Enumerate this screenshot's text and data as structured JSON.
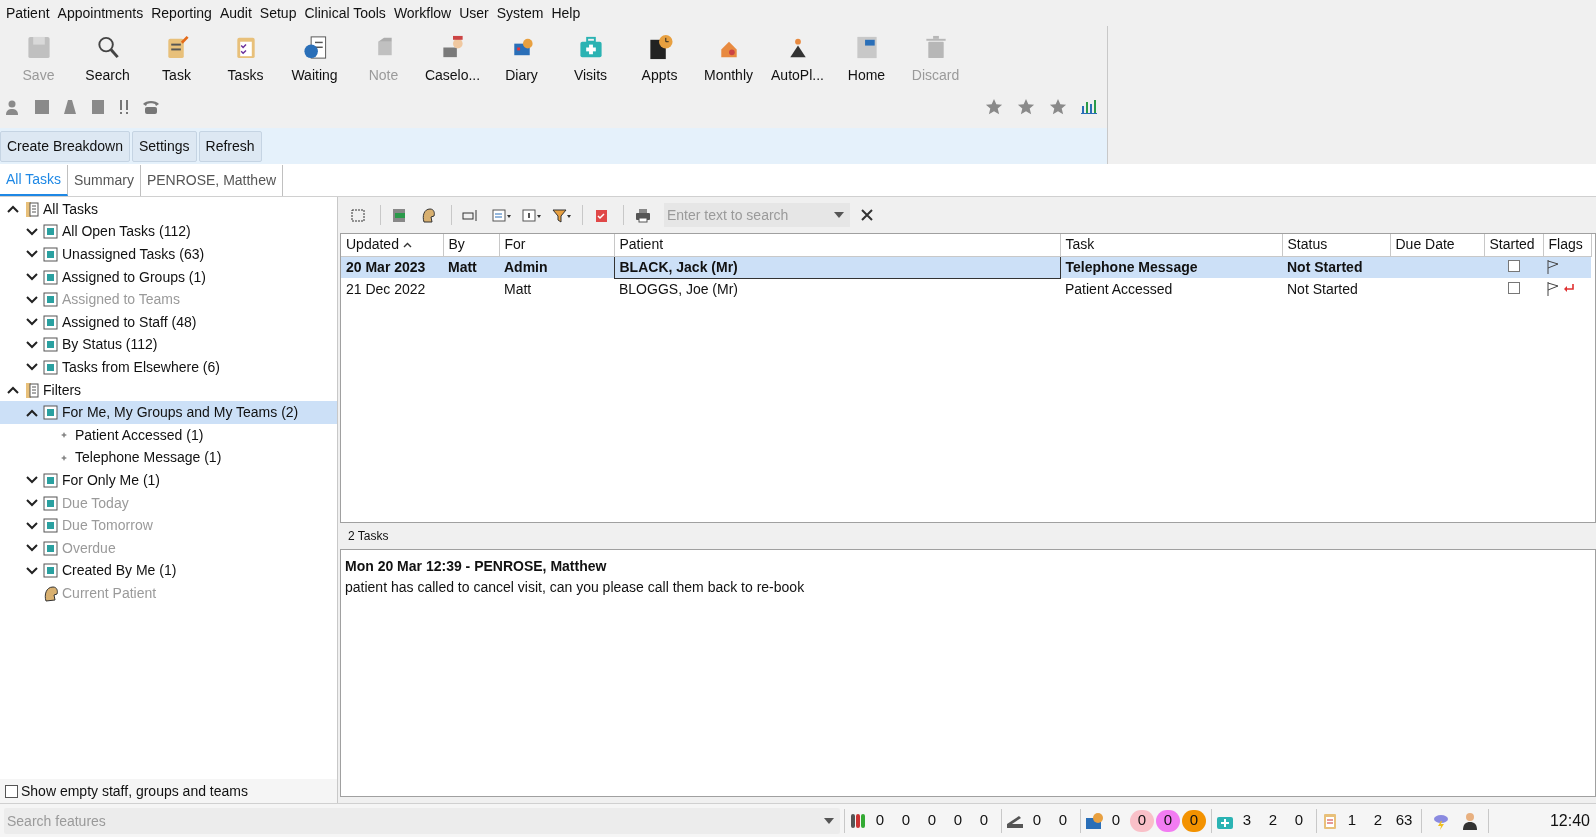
{
  "menu": [
    "Patient",
    "Appointments",
    "Reporting",
    "Audit",
    "Setup",
    "Clinical Tools",
    "Workflow",
    "User",
    "System",
    "Help"
  ],
  "toolbar": [
    {
      "label": "Save",
      "disabled": true
    },
    {
      "label": "Search",
      "disabled": false
    },
    {
      "label": "Task",
      "disabled": false
    },
    {
      "label": "Tasks",
      "disabled": false
    },
    {
      "label": "Waiting",
      "disabled": false
    },
    {
      "label": "Note",
      "disabled": true
    },
    {
      "label": "Caselo...",
      "disabled": false
    },
    {
      "label": "Diary",
      "disabled": false
    },
    {
      "label": "Visits",
      "disabled": false
    },
    {
      "label": "Appts",
      "disabled": false
    },
    {
      "label": "Monthly",
      "disabled": false
    },
    {
      "label": "AutoPl...",
      "disabled": false
    },
    {
      "label": "Home",
      "disabled": false
    },
    {
      "label": "Discard",
      "disabled": true
    }
  ],
  "actions": [
    "Create Breakdown",
    "Settings",
    "Refresh"
  ],
  "tabs": [
    {
      "label": "All Tasks",
      "selected": true
    },
    {
      "label": "Summary",
      "selected": false
    },
    {
      "label": "PENROSE, Matthew",
      "selected": false
    }
  ],
  "tree": [
    {
      "kind": "branch",
      "label": "All Tasks",
      "expanded": true,
      "disabled": false,
      "selected": false,
      "children": [
        {
          "kind": "branch",
          "label": "All Open Tasks (112)",
          "expanded": false,
          "disabled": false,
          "selected": false
        },
        {
          "kind": "branch",
          "label": "Unassigned Tasks (63)",
          "expanded": false,
          "disabled": false,
          "selected": false
        },
        {
          "kind": "branch",
          "label": "Assigned to Groups (1)",
          "expanded": false,
          "disabled": false,
          "selected": false
        },
        {
          "kind": "branch",
          "label": "Assigned to Teams",
          "expanded": false,
          "disabled": true,
          "selected": false
        },
        {
          "kind": "branch",
          "label": "Assigned to Staff (48)",
          "expanded": false,
          "disabled": false,
          "selected": false
        },
        {
          "kind": "branch",
          "label": "By Status (112)",
          "expanded": false,
          "disabled": false,
          "selected": false
        },
        {
          "kind": "branch",
          "label": "Tasks from Elsewhere (6)",
          "expanded": false,
          "disabled": false,
          "selected": false
        }
      ]
    },
    {
      "kind": "branch",
      "label": "Filters",
      "expanded": true,
      "disabled": false,
      "selected": false,
      "children": [
        {
          "kind": "branch",
          "label": "For Me, My Groups and My Teams (2)",
          "expanded": true,
          "disabled": false,
          "selected": true,
          "children": [
            {
              "kind": "bullet",
              "label": "Patient Accessed (1)",
              "disabled": false,
              "selected": false
            },
            {
              "kind": "bullet",
              "label": "Telephone Message (1)",
              "disabled": false,
              "selected": false
            }
          ]
        },
        {
          "kind": "branch",
          "label": "For Only Me (1)",
          "expanded": false,
          "disabled": false,
          "selected": false
        },
        {
          "kind": "branch",
          "label": "Due Today",
          "expanded": false,
          "disabled": true,
          "selected": false
        },
        {
          "kind": "branch",
          "label": "Due Tomorrow",
          "expanded": false,
          "disabled": true,
          "selected": false
        },
        {
          "kind": "branch",
          "label": "Overdue",
          "expanded": false,
          "disabled": true,
          "selected": false
        },
        {
          "kind": "branch",
          "label": "Created By Me (1)",
          "expanded": false,
          "disabled": false,
          "selected": false
        },
        {
          "kind": "plain",
          "label": "Current Patient",
          "disabled": true,
          "selected": false
        }
      ]
    }
  ],
  "show_empty": {
    "label": "Show empty staff, groups and teams",
    "checked": false
  },
  "grid_search": {
    "placeholder": "Enter text to search"
  },
  "columns": [
    {
      "label": "Updated",
      "sorted": true
    },
    {
      "label": "By",
      "sorted": false
    },
    {
      "label": "For",
      "sorted": false
    },
    {
      "label": "Patient",
      "sorted": false
    },
    {
      "label": "Task",
      "sorted": false
    },
    {
      "label": "Status",
      "sorted": false
    },
    {
      "label": "Due Date",
      "sorted": false
    },
    {
      "label": "Started",
      "sorted": false
    },
    {
      "label": "Flags",
      "sorted": false
    }
  ],
  "rows": [
    {
      "cells": [
        "20 Mar 2023",
        "Matt",
        "Admin",
        "BLACK, Jack (Mr)",
        "Telephone Message",
        "Not Started"
      ],
      "selected": true,
      "unread": true,
      "started": false,
      "replied": false
    },
    {
      "cells": [
        "21 Dec 2022",
        "",
        "Matt",
        "BLOGGS, Joe (Mr)",
        "Patient Accessed",
        "Not Started"
      ],
      "selected": false,
      "unread": false,
      "started": false,
      "replied": true
    }
  ],
  "count": "2 Tasks",
  "detail": {
    "heading": "Mon 20 Mar 12:39 - PENROSE, Matthew",
    "body": "patient has called to cancel visit, can you please call them back to re-book"
  },
  "status_bar": {
    "search_placeholder": "Search features",
    "groups": [
      [
        {
          "text": "0"
        },
        {
          "text": "0"
        },
        {
          "text": "0"
        },
        {
          "text": "0"
        },
        {
          "text": "0"
        }
      ],
      [
        {
          "text": "0"
        },
        {
          "text": "0"
        }
      ],
      [
        {
          "text": "0"
        },
        {
          "text": "0",
          "color": "#f9c0c8"
        },
        {
          "text": "0",
          "color": "#f27cf2"
        },
        {
          "text": "0",
          "color": "#f39200"
        }
      ],
      [
        {
          "text": "3"
        },
        {
          "text": "2"
        },
        {
          "text": "0"
        }
      ],
      [
        {
          "text": "1"
        },
        {
          "text": "2"
        },
        {
          "text": "63"
        }
      ]
    ],
    "time": "12:40"
  }
}
